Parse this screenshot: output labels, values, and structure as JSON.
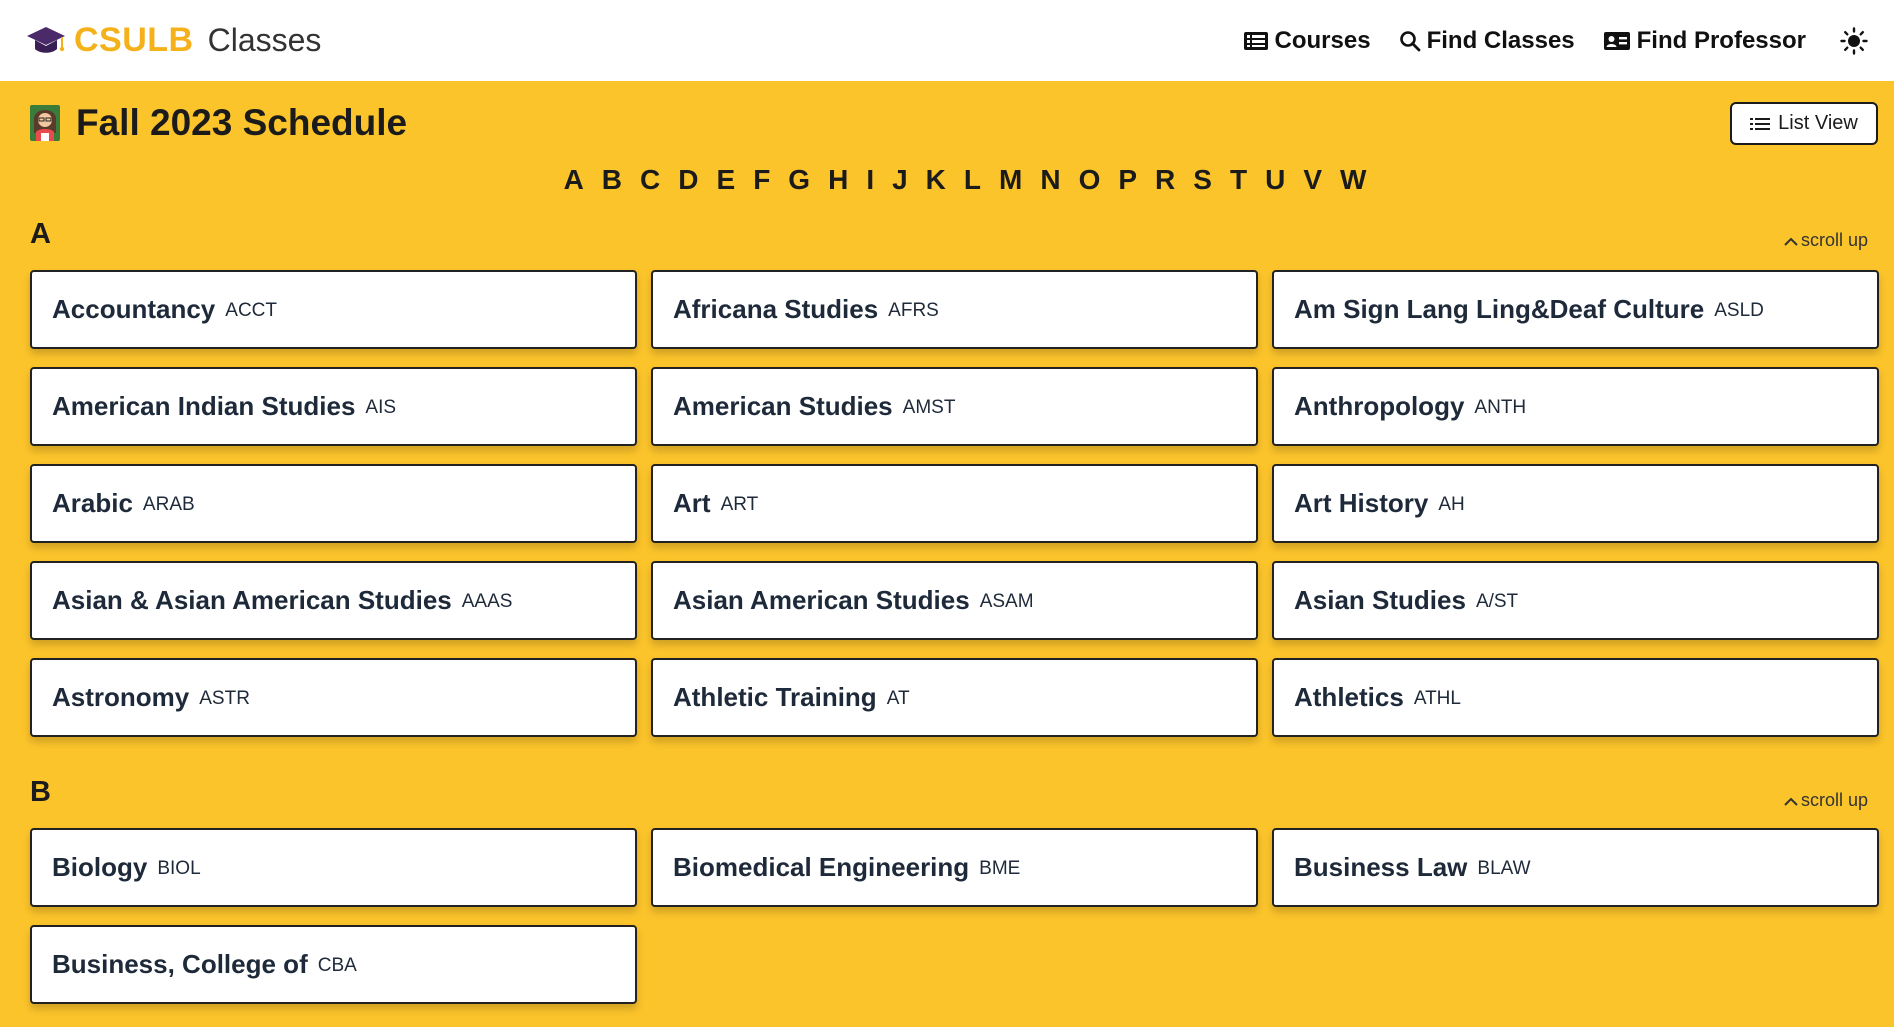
{
  "brand": {
    "main": "CSULB",
    "sub": "Classes"
  },
  "nav": {
    "courses": "Courses",
    "find_classes": "Find Classes",
    "find_professor": "Find Professor"
  },
  "page": {
    "title": "Fall 2023 Schedule",
    "list_view": "List View"
  },
  "alphabet": [
    "A",
    "B",
    "C",
    "D",
    "E",
    "F",
    "G",
    "H",
    "I",
    "J",
    "K",
    "L",
    "M",
    "N",
    "O",
    "P",
    "R",
    "S",
    "T",
    "U",
    "V",
    "W"
  ],
  "sections": [
    {
      "letter": "A",
      "scroll_up": "scroll up",
      "subjects": [
        {
          "name": "Accountancy",
          "code": "ACCT"
        },
        {
          "name": "Africana Studies",
          "code": "AFRS"
        },
        {
          "name": "Am Sign Lang Ling&Deaf Culture",
          "code": "ASLD"
        },
        {
          "name": "American Indian Studies",
          "code": "AIS"
        },
        {
          "name": "American Studies",
          "code": "AMST"
        },
        {
          "name": "Anthropology",
          "code": "ANTH"
        },
        {
          "name": "Arabic",
          "code": "ARAB"
        },
        {
          "name": "Art",
          "code": "ART"
        },
        {
          "name": "Art History",
          "code": "AH"
        },
        {
          "name": "Asian & Asian American Studies",
          "code": "AAAS"
        },
        {
          "name": "Asian American Studies",
          "code": "ASAM"
        },
        {
          "name": "Asian Studies",
          "code": "A/ST"
        },
        {
          "name": "Astronomy",
          "code": "ASTR"
        },
        {
          "name": "Athletic Training",
          "code": "AT"
        },
        {
          "name": "Athletics",
          "code": "ATHL"
        }
      ]
    },
    {
      "letter": "B",
      "scroll_up": "scroll up",
      "subjects": [
        {
          "name": "Biology",
          "code": "BIOL"
        },
        {
          "name": "Biomedical Engineering",
          "code": "BME"
        },
        {
          "name": "Business Law",
          "code": "BLAW"
        },
        {
          "name": "Business, College of",
          "code": "CBA"
        }
      ]
    }
  ],
  "colors": {
    "background": "#FCC42B",
    "brand": "#F5B11A",
    "card": "#FFFFFF",
    "text": "#1e2a3a"
  },
  "icons": {
    "logo": "graduation-cap-icon",
    "courses": "list-icon",
    "find_classes": "search-icon",
    "find_professor": "id-card-icon",
    "theme": "sun-icon",
    "avatar": "professor-avatar-icon",
    "list_view": "list-icon",
    "scroll_up": "chevron-up-icon"
  }
}
